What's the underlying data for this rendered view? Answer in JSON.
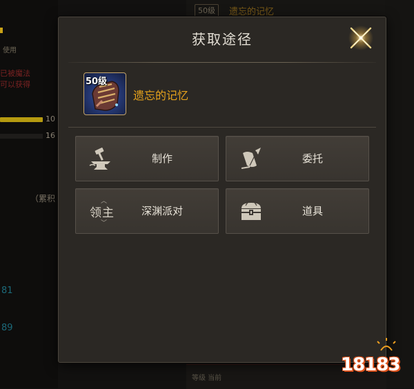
{
  "background": {
    "left_usage_text": "使用",
    "left_red_line1": "已被魔法",
    "left_red_line2": "可以获得",
    "bar1_value": "10",
    "bar2_value": "16",
    "cumulative_text": "（累积",
    "number1": "81",
    "number2": "89",
    "top_badge": "50级",
    "top_title": "遗忘的记忆",
    "bottom_level_text": "等级  当前"
  },
  "dialog": {
    "title": "获取途径",
    "item": {
      "level": "50级",
      "name": "遗忘的记忆",
      "icon": "gauntlet-icon"
    },
    "options": [
      {
        "label": "制作",
        "icon": "anvil-hammer-icon"
      },
      {
        "label": "委托",
        "icon": "scroll-quill-icon"
      },
      {
        "label": "深渊派对",
        "icon_text": "领主",
        "icon": "lord-badge-icon"
      },
      {
        "label": "道具",
        "icon": "treasure-chest-icon"
      }
    ]
  },
  "watermark": {
    "text": "18183"
  },
  "colors": {
    "dialog_bg": "#2b2824",
    "item_name": "#e6a21c",
    "button_bg": "#3d3833",
    "title_text": "#e2ddd3"
  }
}
